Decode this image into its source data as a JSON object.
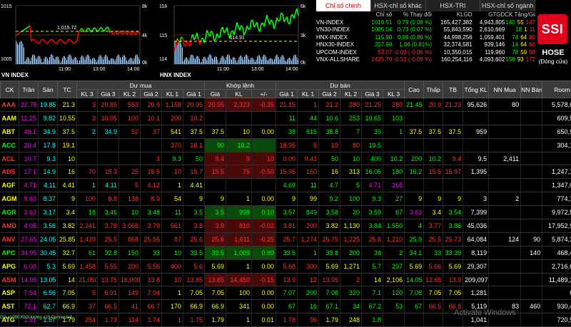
{
  "charts": [
    {
      "title": "VN INDEX",
      "y_top": "1015",
      "y_mid": "",
      "y_bottom": "1005",
      "right_top": "8k",
      "right_mid": "4k",
      "right_bottom": "0k",
      "marker": "1,015.72",
      "x": [
        "11:00",
        "13:00",
        "14:00"
      ]
    },
    {
      "title": "HNX INDEX",
      "y_top": "116",
      "y_mid": "115",
      "y_bottom": "114",
      "right_top": "6k",
      "right_mid": "3k",
      "right_bottom": "0k",
      "marker": "114.91",
      "x": [
        "11:00",
        "13:00",
        "14:00"
      ]
    }
  ],
  "tabs": [
    "Chỉ số chính",
    "HSX-chỉ số khác",
    "HSX-TRI",
    "HSX-chỉ số ngành"
  ],
  "index_head": [
    "",
    "Chỉ số",
    "% Thay đổi",
    "KLGD",
    "GTGD",
    "CK Tăng/Giảm"
  ],
  "indexes": [
    {
      "name": "VN-INDEX",
      "val": "1016.51",
      "chg": "0.79 (0.08 %)",
      "vol": "165,427,382",
      "val2": "4,943,805",
      "up": "140",
      "ref": "55",
      "dn": "147",
      "color": "#0f0"
    },
    {
      "name": "VN30-INDEX",
      "val": "1005.04",
      "chg": "0.73 (0.07 %)",
      "vol": "55,843,590",
      "val2": "2,610,669",
      "up": "18",
      "ref": "1",
      "dn": "11",
      "color": "#0f0"
    },
    {
      "name": "HNX-INDEX",
      "val": "115.90",
      "chg": "0.99 (0.86 %)",
      "vol": "44,998,256",
      "val2": "1,059,401",
      "up": "74",
      "ref": "64",
      "dn": "80",
      "color": "#0f0"
    },
    {
      "name": "HNX30-INDEX",
      "val": "207.98",
      "chg": "1.66 (0.81%)",
      "vol": "32,374,581",
      "val2": "939,146",
      "up": "14",
      "ref": "64",
      "dn": "60",
      "color": "#0f0"
    },
    {
      "name": "UPCOM-INDEX",
      "val": "53.07",
      "chg": "-0.03 (-0.06 %)",
      "vol": "10,350,015",
      "val2": "119,960",
      "up": "78",
      "ref": "59",
      "dn": "58",
      "color": "#f33"
    },
    {
      "name": "VNX-ALLSHARE",
      "val": "1425.79",
      "chg": "-0.52 (-0.06 %)",
      "vol": "160,254,116",
      "val2": "4,093,602",
      "up": "158",
      "ref": "93",
      "dn": "172",
      "color": "#f33"
    }
  ],
  "logo": "SSI",
  "exchange": "HOSE",
  "exchange_status": "(Đóng cửa)",
  "group_headers": {
    "buy": "Dư mua",
    "match": "Khớp lệnh",
    "sell": "Dư bán"
  },
  "columns": [
    "CK",
    "Trần",
    "Sàn",
    "TC",
    "KL 3",
    "Giá 3",
    "KL 2",
    "Giá 2",
    "KL 1",
    "Giá 1",
    "Giá",
    "KL",
    "+/-",
    "Giá 1",
    "KL 1",
    "Giá 2",
    "KL 2",
    "Giá 3",
    "KL 3",
    "Cao",
    "Thấp",
    "TB",
    "Tổng KL",
    "NN Mua",
    "NN Bán",
    "Room"
  ],
  "rows": [
    [
      "AAA",
      "22.75",
      "19.85",
      "21.3",
      "3",
      "20.85",
      "553",
      "20.9",
      "1,158",
      "20.95",
      "20.95",
      "2,323",
      "-0.35",
      "21.15",
      "1",
      "21.2",
      "280",
      "21.25",
      "280",
      "21.45",
      "20.9",
      "21.23",
      "95,626",
      "80",
      "",
      "5,578,689"
    ],
    [
      "AAM",
      "11.25",
      "9.82",
      "10.55",
      "3",
      "10.05",
      "100",
      "10.1",
      "200",
      "10.2",
      "",
      "",
      "",
      "11",
      "44",
      "10.6",
      "253",
      "10.65",
      "103",
      "",
      "",
      "",
      "",
      "",
      "",
      "609,576"
    ],
    [
      "ABT",
      "40.1",
      "34.9",
      "37.5",
      "2",
      "34.9",
      "52",
      "37",
      "541",
      "37.5",
      "37.5",
      "10",
      "0.00",
      "38",
      "615",
      "38.8",
      "7",
      "39",
      "1",
      "37.5",
      "37.5",
      "37.5",
      "959",
      "",
      "",
      "650,918"
    ],
    [
      "ACC",
      "20.4",
      "17.8",
      "19.1",
      "",
      "",
      "",
      "",
      "370",
      "18.1",
      "90",
      "18.2",
      "",
      "18.95",
      "5",
      "19",
      "80",
      "19.5",
      "",
      "",
      "",
      "",
      "",
      "",
      "",
      "304,125"
    ],
    [
      "ACL",
      "10.7",
      "9.3",
      "10",
      "",
      "",
      "",
      "3",
      "9.3",
      "50",
      "9.4",
      "9",
      "10",
      "0.00",
      "9.43",
      "50",
      "10",
      "400",
      "10.2",
      "200",
      "10.2",
      "9.4",
      "9.5",
      "2,411",
      "",
      "",
      "1,260,797"
    ],
    [
      "ADS",
      "17.1",
      "14.9",
      "16",
      "70",
      "15.3",
      "25",
      "15.5",
      "10",
      "15.7",
      "15.5",
      "75",
      "-0.50",
      "15.95",
      "160",
      "16",
      "313",
      "16.05",
      "180",
      "16.2",
      "15.5",
      "15.97",
      "1,395",
      "",
      "",
      "1,247,137"
    ],
    [
      "AGF",
      "4.71",
      "4.11",
      "4.41",
      "1",
      "4.11",
      "5",
      "4.12",
      "1",
      "4.41",
      "",
      "",
      "",
      "4.69",
      "11",
      "4.7",
      "5",
      "4.71",
      "265",
      "",
      "",
      "",
      "",
      "",
      "",
      "1,347,093"
    ],
    [
      "AGM",
      "9.63",
      "8.37",
      "9",
      "100",
      "8.8",
      "138",
      "8.9",
      "54",
      "9",
      "9",
      "1",
      "0.00",
      "9",
      "99",
      "9.2",
      "100",
      "9.3",
      "27",
      "9",
      "9",
      "9",
      "3",
      "2",
      "",
      "774,163"
    ],
    [
      "AGR",
      "3.63",
      "3.17",
      "3.4",
      "18",
      "3.46",
      "10",
      "3.48",
      "11",
      "3.5",
      "3.5",
      "998",
      "0.10",
      "3.57",
      "849",
      "3.58",
      "20",
      "3.59",
      "67",
      "3.63",
      "3.4",
      "3.54",
      "7,399",
      "",
      "",
      "9,972,536"
    ],
    [
      "AMD",
      "4.08",
      "3.56",
      "3.82",
      "2,241",
      "3.78",
      "3,068",
      "3.79",
      "561",
      "3.8",
      "3.8",
      "810",
      "-0.02",
      "3.81",
      "200",
      "3.82",
      "1,130",
      "3.84",
      "1,550",
      "4",
      "3.77",
      "3.86",
      "45,036",
      "",
      "",
      "17,952,980"
    ],
    [
      "ANV",
      "27.65",
      "24.05",
      "25.85",
      "1,439",
      "25.5",
      "868",
      "25.55",
      "87",
      "25.6",
      "25.6",
      "1,611",
      "-0.25",
      "25.7",
      "1,274",
      "25.75",
      "1,225",
      "25.8",
      "1,210",
      "25.9",
      "25.5",
      "25.73",
      "64,084",
      "124",
      "90",
      "5,874,310"
    ],
    [
      "APC",
      "34.95",
      "30.45",
      "32.7",
      "61",
      "32.8",
      "150",
      "33",
      "10",
      "33.5",
      "33.5",
      "1,009",
      "0.80",
      "33.5",
      "1",
      "33.8",
      "200",
      "34",
      "2",
      "34.1",
      "33",
      "33.39",
      "8,119",
      "",
      "140",
      "468,405"
    ],
    [
      "APG",
      "6.08",
      "5.3",
      "5.69",
      "1,458",
      "5.55",
      "200",
      "5.56",
      "400",
      "5.6",
      "5.69",
      "1",
      "0.00",
      "5.68",
      "300",
      "5.69",
      "1,271",
      "5.7",
      "297",
      "5.69",
      "5.66",
      "5.69",
      "29,307",
      "",
      "",
      "2,716,620"
    ],
    [
      "ASM",
      "14.95",
      "13.05",
      "14",
      "21,050",
      "13.75",
      "16,000",
      "13.8",
      "10",
      "13.85",
      "13.85",
      "14,450",
      "-0.15",
      "13.9",
      "12",
      "13.95",
      "2",
      "14",
      "2,106",
      "14.05",
      "13.65",
      "13.9",
      "209,097",
      "",
      "",
      "11,489,396"
    ],
    [
      "ASP",
      "7.54",
      "6.56",
      "7.05",
      "5",
      "6.91",
      "149",
      "7.04",
      "1",
      "7.05",
      "7.05",
      "100",
      "0.00",
      "7.07",
      "200",
      "7.08",
      "320",
      "7.1",
      "120",
      "7.08",
      "7.05",
      "7.05",
      "1,281",
      "",
      "",
      "691"
    ],
    [
      "AST",
      "72.1",
      "62.7",
      "66.9",
      "37",
      "66.5",
      "41",
      "66.7",
      "170",
      "66.9",
      "66.9",
      "341",
      "0.00",
      "67",
      "16",
      "67.1",
      "34",
      "67.2",
      "53",
      "67",
      "66.5",
      "66.8",
      "5,119",
      "83",
      "460",
      "930,465"
    ],
    [
      "ATG",
      "1.91",
      "1.67",
      "1.79",
      "254",
      "1.73",
      "114",
      "1.74",
      "1",
      "1.75",
      "1.79",
      "1",
      "0.01",
      "1.78",
      "96",
      "1.79",
      "248",
      "1.8",
      "",
      "",
      "",
      "",
      "1,041",
      "",
      "",
      "720,567"
    ]
  ],
  "footer": "Giá x1000 Khối lượng x10 Connected",
  "watermark": "Activate Windows"
}
